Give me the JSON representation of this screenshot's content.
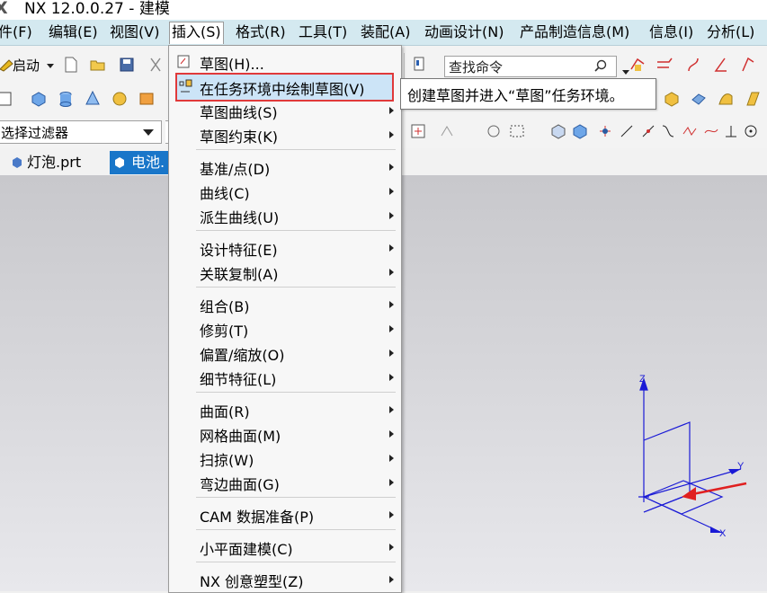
{
  "window": {
    "title": "NX 12.0.0.27 - 建模"
  },
  "menubar": {
    "items": [
      {
        "label": "件(F)"
      },
      {
        "label": "编辑(E)"
      },
      {
        "label": "视图(V)"
      },
      {
        "label": "插入(S)"
      },
      {
        "label": "格式(R)"
      },
      {
        "label": "工具(T)"
      },
      {
        "label": "装配(A)"
      },
      {
        "label": "动画设计(N)"
      },
      {
        "label": "产品制造信息(M)"
      },
      {
        "label": "信息(I)"
      },
      {
        "label": "分析(L)"
      }
    ]
  },
  "toolbar": {
    "start_label": "启动",
    "search_placeholder": "查找命令",
    "filter_value": "选择过滤器"
  },
  "tabs": [
    {
      "label": "灯泡.prt"
    },
    {
      "label": "电池."
    }
  ],
  "insert_menu": {
    "items": [
      {
        "label": "草图(H)...",
        "submenu": false
      },
      {
        "label": "在任务环境中绘制草图(V)",
        "submenu": false,
        "highlighted": true
      },
      {
        "label": "草图曲线(S)",
        "submenu": true
      },
      {
        "label": "草图约束(K)",
        "submenu": true
      },
      {
        "label": "基准/点(D)",
        "submenu": true
      },
      {
        "label": "曲线(C)",
        "submenu": true
      },
      {
        "label": "派生曲线(U)",
        "submenu": true
      },
      {
        "label": "设计特征(E)",
        "submenu": true
      },
      {
        "label": "关联复制(A)",
        "submenu": true
      },
      {
        "label": "组合(B)",
        "submenu": true
      },
      {
        "label": "修剪(T)",
        "submenu": true
      },
      {
        "label": "偏置/缩放(O)",
        "submenu": true
      },
      {
        "label": "细节特征(L)",
        "submenu": true
      },
      {
        "label": "曲面(R)",
        "submenu": true
      },
      {
        "label": "网格曲面(M)",
        "submenu": true
      },
      {
        "label": "扫掠(W)",
        "submenu": true
      },
      {
        "label": "弯边曲面(G)",
        "submenu": true
      },
      {
        "label": "CAM 数据准备(P)",
        "submenu": true
      },
      {
        "label": "小平面建模(C)",
        "submenu": true
      },
      {
        "label": "NX 创意塑型(Z)",
        "submenu": true
      }
    ]
  },
  "tooltip": {
    "text": "创建草图并进入“草图”任务环境。"
  },
  "triad": {
    "x_label": "X",
    "y_label": "Y",
    "z_label": "Z"
  },
  "colors": {
    "menubar": "#d4e9f0",
    "tab_active": "#1976c9",
    "highlight_border": "#e0393a",
    "triad": "#1a1ad6",
    "arrow": "#e02020"
  }
}
